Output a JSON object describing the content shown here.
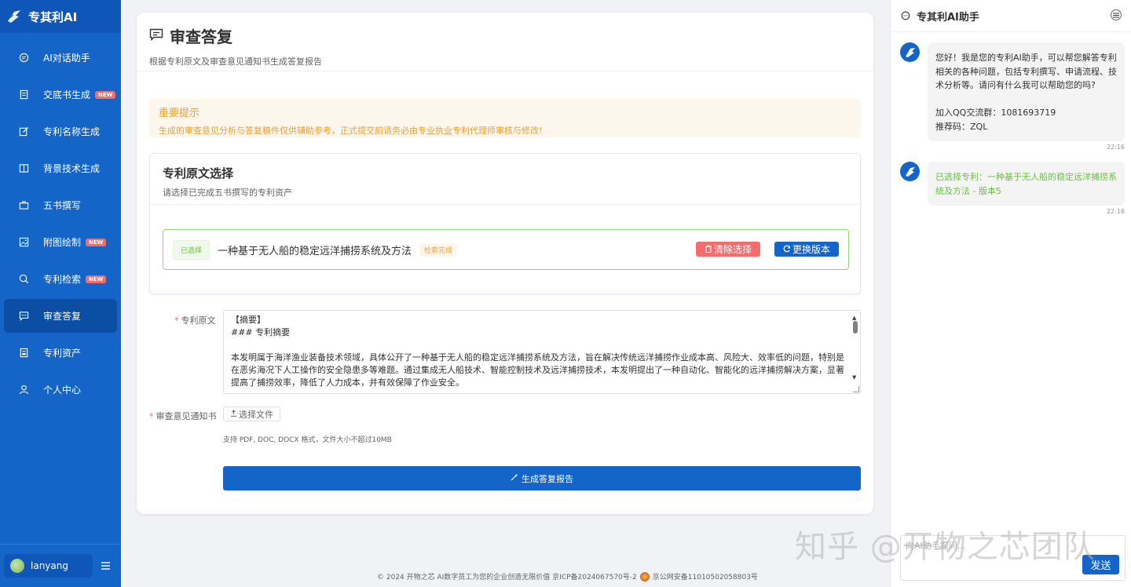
{
  "app": {
    "name": "专其利AI"
  },
  "sidebar": {
    "items": [
      {
        "label": "AI对话助手",
        "icon": "chat-bubble-icon",
        "new": false
      },
      {
        "label": "交底书生成",
        "icon": "document-icon",
        "new": true
      },
      {
        "label": "专利名称生成",
        "icon": "edit-icon",
        "new": false
      },
      {
        "label": "背景技术生成",
        "icon": "book-icon",
        "new": false
      },
      {
        "label": "五书撰写",
        "icon": "briefcase-icon",
        "new": false
      },
      {
        "label": "附图绘制",
        "icon": "image-icon",
        "new": true
      },
      {
        "label": "专利检索",
        "icon": "search-icon",
        "new": true
      },
      {
        "label": "审查答复",
        "icon": "message-icon",
        "new": false,
        "active": true
      },
      {
        "label": "专利资产",
        "icon": "folder-icon",
        "new": false
      },
      {
        "label": "个人中心",
        "icon": "user-icon",
        "new": false
      }
    ],
    "new_badge": "NEW",
    "user": {
      "name": "lanyang"
    }
  },
  "page": {
    "title": "审查答复",
    "subtitle": "根据专利原文及审查意见通知书生成答复报告"
  },
  "notice": {
    "title": "重要提示",
    "text": "生成的审查意见分析与答复稿件仅供辅助参考，正式提交前请务必由专业执业专利代理师审核与修改!"
  },
  "patent_select": {
    "title": "专利原文选择",
    "subtitle": "请选择已完成五书撰写的专利资产",
    "selected_tag": "已选择",
    "patent_name": "一种基于无人船的稳定远洋捕捞系统及方法",
    "status_tag": "检索完成",
    "clear_label": "清除选择",
    "switch_label": "更换版本"
  },
  "form": {
    "original_label": "专利原文",
    "original_lines": [
      "【摘要】",
      "### 专利摘要",
      "",
      "本发明属于海洋渔业装备技术领域，具体公开了一种基于无人船的稳定远洋捕捞系统及方法，旨在解决传统远洋捕捞作业成本高、风险大、效率低的问题，特别是在恶劣海况下人工操作的安全隐患多等难题。通过集成无人船技术、智能控制技术及远洋捕捞技术，本发明提出了一种自动化、智能化的远洋捕捞解决方案，显著提高了捕捞效率，降低了人力成本，并有效保障了作业安全。"
    ],
    "notice_label": "审查意见通知书",
    "file_button": "选择文件",
    "file_hint": "支持 PDF, DOC, DOCX 格式，文件大小不超过10MB",
    "generate_button": "生成答复报告"
  },
  "footer": {
    "copyright": "© 2024 开物之芯 AI数字员工为您的企业创造无限价值 京ICP备2024067570号-2",
    "police": "京公网安备11010502058803号"
  },
  "assistant": {
    "title": "专其利AI助手",
    "messages": [
      {
        "text": "您好！我是您的专利AI助手，可以帮您解答专利相关的各种问题，包括专利撰写、申请流程、技术分析等。请问有什么我可以帮助您的吗?\n\n加入QQ交流群：1081693719\n推荐码：ZQL",
        "time": "22:16"
      },
      {
        "text": "已选择专利：一种基于无人船的稳定远洋捕捞系统及方法 - 版本5",
        "time": "22:16"
      }
    ],
    "input_placeholder": "向AI助手提问...",
    "send_label": "发送"
  },
  "watermark": "知乎 @开物之芯团队",
  "colors": {
    "primary": "#1565c8",
    "danger": "#f56c6c",
    "warning": "#e6a23c",
    "success": "#67c23a"
  }
}
